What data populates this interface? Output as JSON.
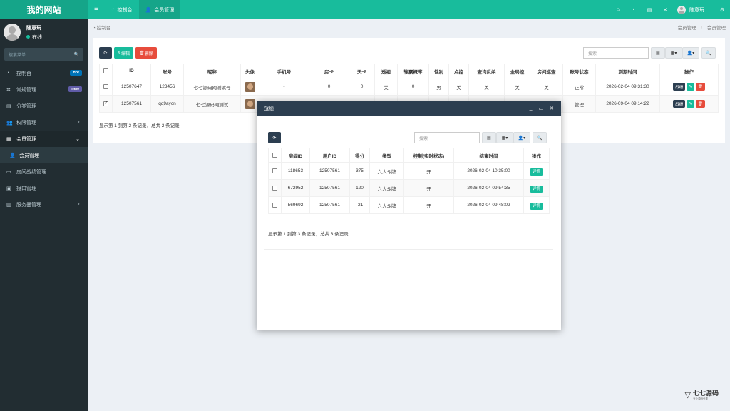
{
  "header": {
    "logo": "我的网站",
    "menu_icon": "bars-icon",
    "tabs": [
      {
        "label": "控制台",
        "icon": "dashboard-icon"
      },
      {
        "label": "会员管理",
        "icon": "user-icon"
      }
    ],
    "username": "随意玩"
  },
  "sidebar": {
    "user_name": "随意玩",
    "status": "在线",
    "search_placeholder": "搜索菜单",
    "items": [
      {
        "label": "控制台",
        "badge": "hot",
        "badge_color": "#0073b7"
      },
      {
        "label": "常规管理",
        "badge": "new",
        "badge_color": "#605ca8"
      },
      {
        "label": "分类管理"
      },
      {
        "label": "权限管理",
        "arrow": "‹"
      },
      {
        "label": "会员管理",
        "arrow": "⌄"
      },
      {
        "label": "会员管理"
      },
      {
        "label": "房间战绩管理"
      },
      {
        "label": "接口管理"
      },
      {
        "label": "服务器管理",
        "arrow": "‹"
      }
    ]
  },
  "breadcrumb": {
    "left": "控制台",
    "right1": "会员管理",
    "sep": "/",
    "right2": "会员管理"
  },
  "toolbar": {
    "edit": "编辑",
    "delete": "删除",
    "search_placeholder": "搜索"
  },
  "member_table": {
    "headers": [
      "ID",
      "账号",
      "昵称",
      "头像",
      "手机号",
      "房卡",
      "天卡",
      "透视",
      "输赢概率",
      "性别",
      "点控",
      "查询反杀",
      "全局控",
      "房间巡查",
      "账号状态",
      "到期时间",
      "操作"
    ],
    "rows": [
      [
        "12507647",
        "123456",
        "七七源码网测试号",
        "",
        "-",
        "0",
        "0",
        "关",
        "0",
        "男",
        "关",
        "关",
        "关",
        "关",
        "正常",
        "2026-02-04 09:31:30"
      ],
      [
        "12507561",
        "qq9aycn",
        "七七源码网测试",
        "",
        "",
        "",
        "",
        "",
        "",
        "",
        "",
        "",
        "",
        "",
        "管理",
        "2026-09-04 09:14:22"
      ]
    ],
    "op_label": "战绩",
    "footer": "显示第 1 到第 2 条记录，总共 2 条记录"
  },
  "modal": {
    "title": "战绩",
    "search_placeholder": "搜索",
    "headers": [
      "房间ID",
      "用户ID",
      "得分",
      "类型",
      "控制(实时状态)",
      "结束时间",
      "操作"
    ],
    "rows": [
      [
        "118653",
        "12507561",
        "375",
        "六人斗牌",
        "开",
        "2026-02-04 10:35:00"
      ],
      [
        "672952",
        "12507561",
        "120",
        "六人斗牌",
        "开",
        "2026-02-04 09:54:35"
      ],
      [
        "569692",
        "12507561",
        "-21",
        "六人斗牌",
        "开",
        "2026-02-04 09:48:02"
      ]
    ],
    "detail_label": "详情",
    "footer": "显示第 1 到第 3 条记录，总共 3 条记录"
  },
  "watermark": {
    "text": "七七源码",
    "sub": "专业源码分享"
  },
  "colors": {
    "brand": "#18bc9c",
    "sidebar": "#222d32",
    "modal_title": "#2c3e50",
    "danger": "#e74c3c"
  }
}
